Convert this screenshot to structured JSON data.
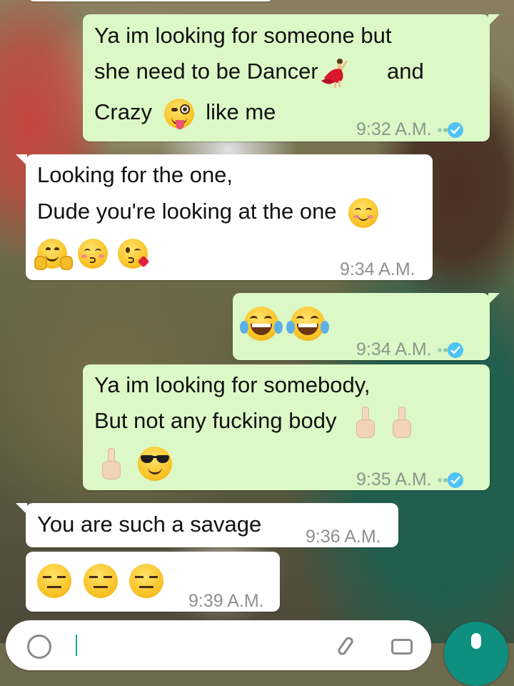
{
  "messages": [
    {
      "direction": "outgoing",
      "lines": [
        "Ya im looking for someone but",
        "she need to be Dancer",
        "and",
        "Crazy",
        "like me"
      ],
      "time": "9:32 A.M.",
      "status": "read",
      "emojis": [
        "dancer-emoji",
        "zany-face-emoji"
      ]
    },
    {
      "direction": "incoming",
      "lines": [
        "Looking for the one,",
        "Dude you're looking at the one"
      ],
      "time": "9:34 A.M.",
      "emojis": [
        "relaxed-face-emoji",
        "hugging-face-emoji",
        "kissing-smiling-eyes-emoji",
        "face-blowing-kiss-emoji"
      ]
    },
    {
      "direction": "outgoing",
      "lines": [],
      "time": "9:34 A.M.",
      "status": "read",
      "emojis": [
        "tears-of-joy-emoji",
        "tears-of-joy-emoji"
      ]
    },
    {
      "direction": "outgoing",
      "lines": [
        "Ya im looking for somebody,",
        "But not any fucking body"
      ],
      "time": "9:35 A.M.",
      "status": "read",
      "emojis": [
        "middle-finger-emoji",
        "middle-finger-emoji",
        "middle-finger-emoji",
        "sunglasses-face-emoji"
      ]
    },
    {
      "direction": "incoming",
      "lines": [
        "You are such a savage"
      ],
      "time": "9:36 A.M."
    },
    {
      "direction": "incoming",
      "lines": [],
      "time": "9:39 A.M.",
      "emojis": [
        "expressionless-face-emoji",
        "expressionless-face-emoji",
        "expressionless-face-emoji"
      ]
    }
  ],
  "colors": {
    "outgoing_bubble": "#dcf8c6",
    "incoming_bubble": "#ffffff",
    "read_tick": "#4fc3f7",
    "send_button": "#0e8f7f"
  },
  "composer": {
    "icons": [
      "emoji-icon",
      "attach-icon",
      "camera-icon",
      "mic-icon"
    ]
  }
}
